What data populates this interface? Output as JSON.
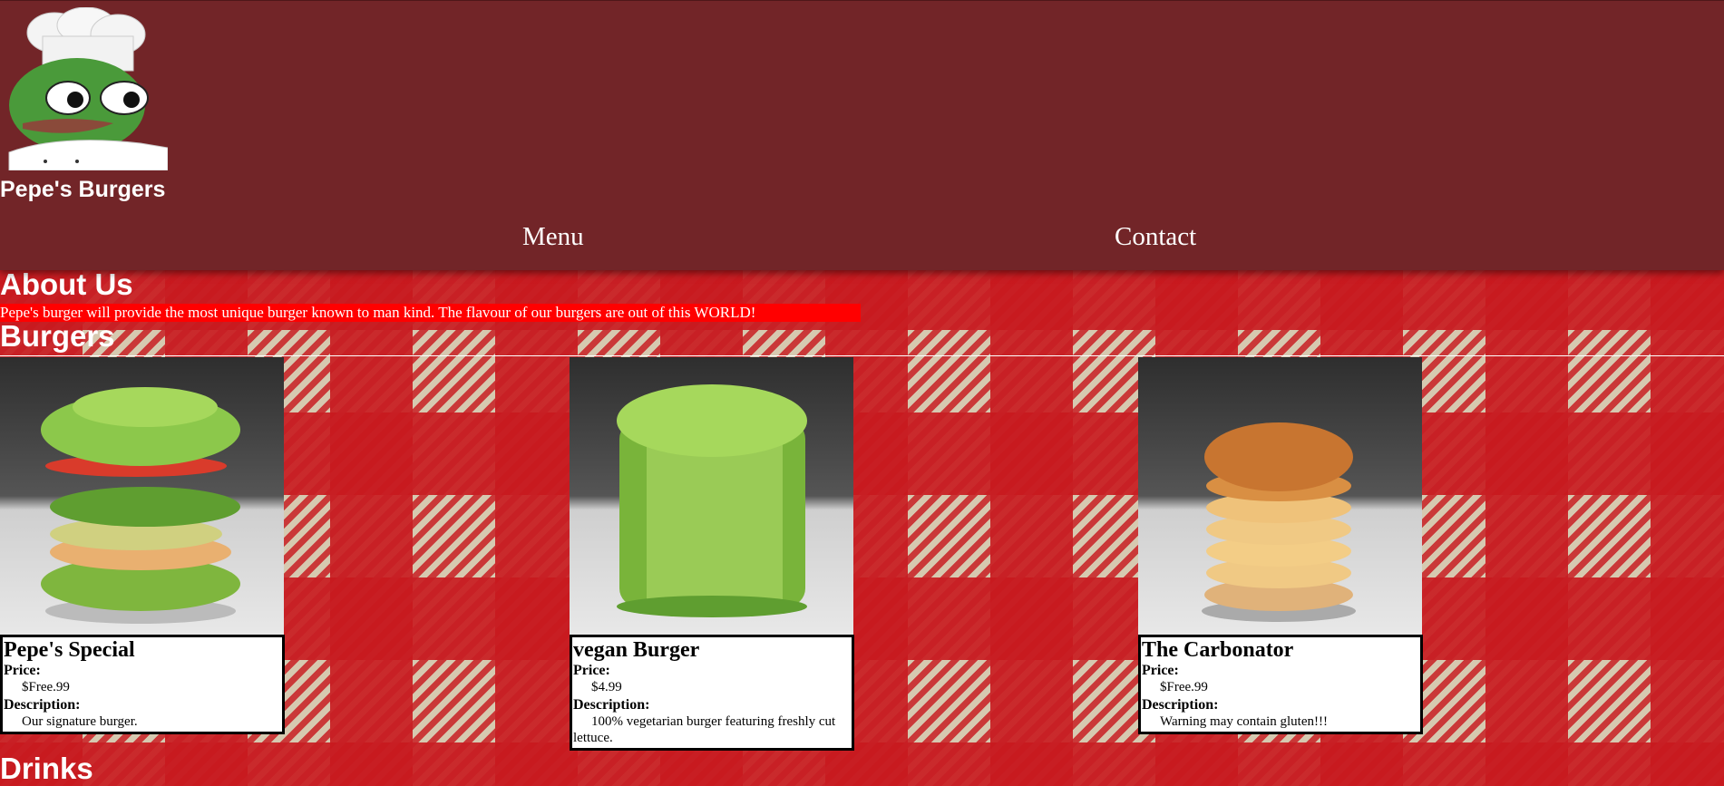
{
  "site": {
    "name": "Pepe's Burgers"
  },
  "nav": {
    "items": [
      {
        "label": "Menu"
      },
      {
        "label": "Contact"
      }
    ]
  },
  "about": {
    "heading": "About Us",
    "text": "Pepe's burger will provide the most unique burger known to man kind. The flavour of our burgers are out of this WORLD!"
  },
  "burgers": {
    "heading": "Burgers",
    "price_label": "Price:",
    "description_label": "Description:",
    "items": [
      {
        "name": "Pepe's Special",
        "price": "$Free.99",
        "description": "Our signature burger."
      },
      {
        "name": "vegan Burger",
        "price": "$4.99",
        "description": "100% vegetarian burger featuring freshly cut lettuce."
      },
      {
        "name": "The Carbonator",
        "price": "$Free.99",
        "description": "Warning may contain gluten!!!"
      }
    ]
  },
  "drinks": {
    "heading": "Drinks"
  },
  "colors": {
    "header": "#722528",
    "about_highlight": "#ff0000",
    "tablecloth_red": "#c8181e",
    "tablecloth_beige": "#d6c9b0"
  }
}
